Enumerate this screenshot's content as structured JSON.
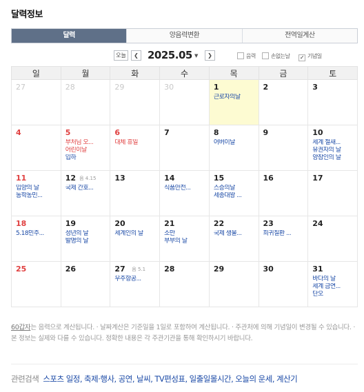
{
  "title": "달력정보",
  "tabs": [
    {
      "label": "달력",
      "active": true
    },
    {
      "label": "양음력변환",
      "active": false
    },
    {
      "label": "전역일계산",
      "active": false
    }
  ],
  "nav": {
    "today_label": "오늘",
    "prev_icon": "chevron-left-icon",
    "next_icon": "chevron-right-icon",
    "month": "2025.05",
    "options": [
      {
        "label": "음력",
        "checked": false
      },
      {
        "label": "손없는날",
        "checked": false
      },
      {
        "label": "기념일",
        "checked": true
      }
    ]
  },
  "weekdays": [
    "일",
    "월",
    "화",
    "수",
    "목",
    "금",
    "토"
  ],
  "weeks": [
    [
      {
        "day": "27",
        "out": true
      },
      {
        "day": "28",
        "out": true
      },
      {
        "day": "29",
        "out": true
      },
      {
        "day": "30",
        "out": true
      },
      {
        "day": "1",
        "today": true,
        "events": [
          {
            "text": "근로자의날"
          }
        ]
      },
      {
        "day": "2"
      },
      {
        "day": "3"
      }
    ],
    [
      {
        "day": "4",
        "red": true
      },
      {
        "day": "5",
        "red": true,
        "events": [
          {
            "text": "부처님 오...",
            "red": true
          },
          {
            "text": "어린이날",
            "red": true
          },
          {
            "text": "입하"
          }
        ]
      },
      {
        "day": "6",
        "red": true,
        "events": [
          {
            "text": "대체 휴일",
            "red": true
          }
        ]
      },
      {
        "day": "7"
      },
      {
        "day": "8",
        "events": [
          {
            "text": "어버이날"
          }
        ]
      },
      {
        "day": "9"
      },
      {
        "day": "10",
        "events": [
          {
            "text": "세계 철새..."
          },
          {
            "text": "유권자의 날"
          },
          {
            "text": "양잠인의 날"
          }
        ]
      }
    ],
    [
      {
        "day": "11",
        "red": true,
        "events": [
          {
            "text": "입양의 날"
          },
          {
            "text": "동학농민..."
          }
        ]
      },
      {
        "day": "12",
        "lunar": "음 4.15",
        "events": [
          {
            "text": "국제 간호..."
          }
        ]
      },
      {
        "day": "13"
      },
      {
        "day": "14",
        "events": [
          {
            "text": "식품안전..."
          }
        ]
      },
      {
        "day": "15",
        "events": [
          {
            "text": "스승의날"
          },
          {
            "text": "세종대왕 ..."
          }
        ]
      },
      {
        "day": "16"
      },
      {
        "day": "17"
      }
    ],
    [
      {
        "day": "18",
        "red": true,
        "events": [
          {
            "text": "5.18민주..."
          }
        ]
      },
      {
        "day": "19",
        "events": [
          {
            "text": "성년의 날"
          },
          {
            "text": "발명의 날"
          }
        ]
      },
      {
        "day": "20",
        "events": [
          {
            "text": "세계인의 날"
          }
        ]
      },
      {
        "day": "21",
        "events": [
          {
            "text": "소만"
          },
          {
            "text": "부부의 날"
          }
        ]
      },
      {
        "day": "22",
        "events": [
          {
            "text": "국제 생물..."
          }
        ]
      },
      {
        "day": "23",
        "events": [
          {
            "text": "희귀질환 ..."
          }
        ]
      },
      {
        "day": "24"
      }
    ],
    [
      {
        "day": "25",
        "red": true
      },
      {
        "day": "26"
      },
      {
        "day": "27",
        "lunar": "음 5.1",
        "events": [
          {
            "text": "우주항공..."
          }
        ]
      },
      {
        "day": "28"
      },
      {
        "day": "29"
      },
      {
        "day": "30"
      },
      {
        "day": "31",
        "events": [
          {
            "text": "바다의 날"
          },
          {
            "text": "세계 금연..."
          },
          {
            "text": "단오"
          }
        ]
      }
    ]
  ],
  "notes": {
    "link": "60갑자",
    "text": "는 음력으로 계산됩니다. · 날짜계산은 기준일을 1일로 포함하여 계산됩니다. · 주관처에 의해 기념일이 변경될 수 있습니다. · 본 정보는 실제와 다를 수 있습니다. 정확한 내용은 각 주관기관을 통해 확인하시기 바랍니다."
  },
  "related": {
    "label": "관련검색",
    "links": [
      "스포츠 일정",
      "축제·행사",
      "공연",
      "날씨",
      "TV편성표",
      "일출일몰시간",
      "오늘의 운세",
      "계산기"
    ]
  },
  "colors": {
    "tab_active": "#5f7088",
    "holiday": "#e04040",
    "event": "#1a49a6",
    "today_bg": "#fdfbd2"
  }
}
